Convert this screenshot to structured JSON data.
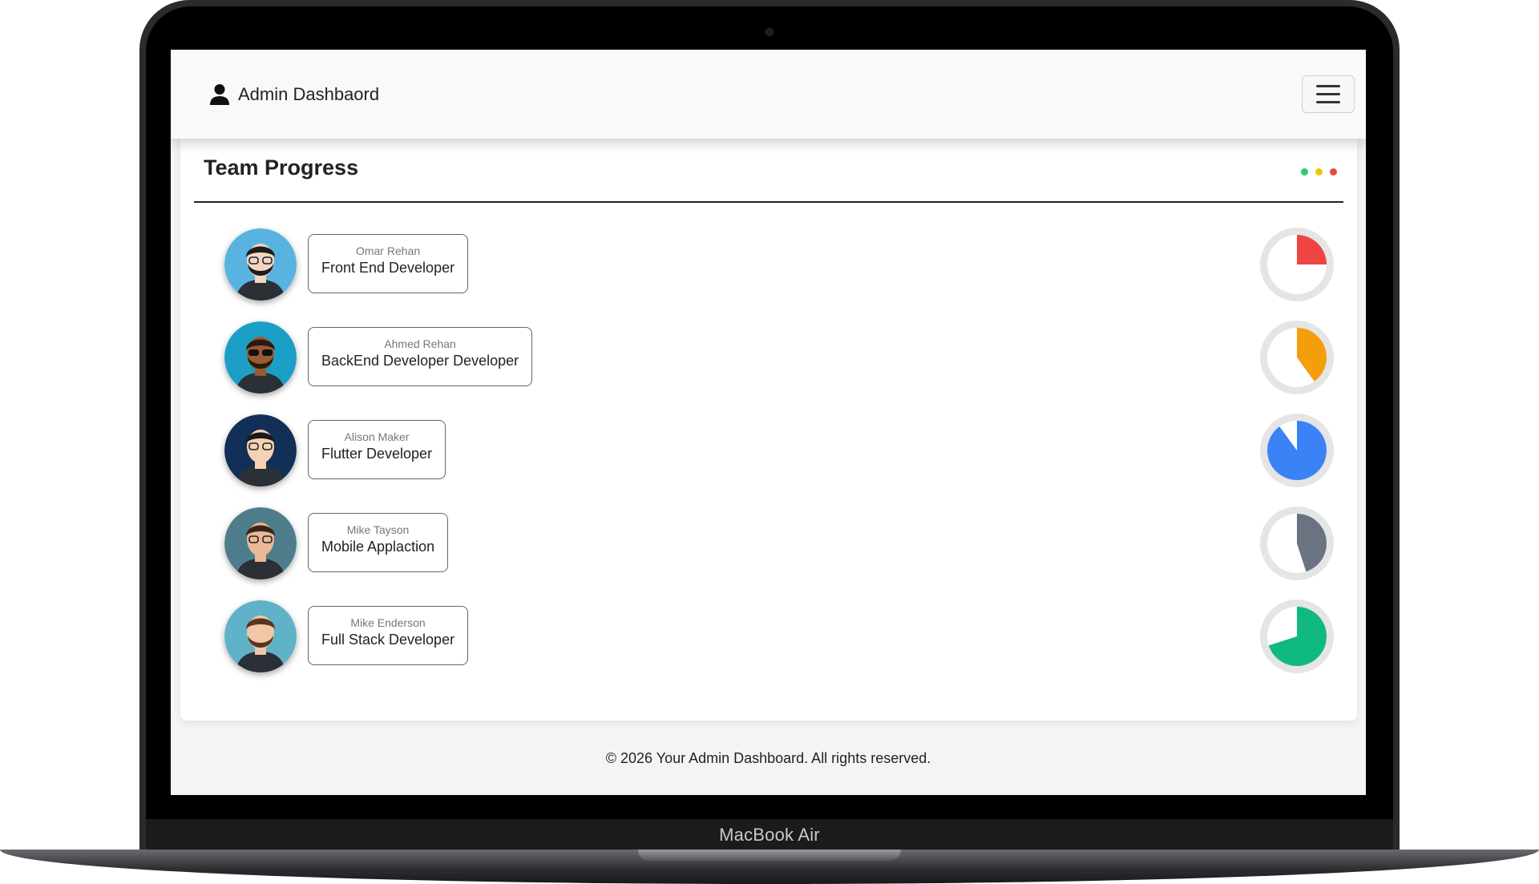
{
  "device": {
    "label": "MacBook Air"
  },
  "navbar": {
    "title": "Admin Dashbaord"
  },
  "card": {
    "title": "Team Progress",
    "dot_colors": [
      "#2ecc71",
      "#f1c40f",
      "#e74c3c"
    ]
  },
  "members": [
    {
      "name": "Omar Rehan",
      "role": "Front End Developer",
      "progress": 0.25,
      "color": "#ef4444",
      "avatar_bg": "#58b3e0"
    },
    {
      "name": "Ahmed Rehan",
      "role": "BackEnd Developer Developer",
      "progress": 0.4,
      "color": "#f59e0b",
      "avatar_bg": "#1b9fc6"
    },
    {
      "name": "Alison Maker",
      "role": "Flutter Developer",
      "progress": 0.9,
      "color": "#3b82f6",
      "avatar_bg": "#122f58"
    },
    {
      "name": "Mike Tayson",
      "role": "Mobile Applaction",
      "progress": 0.45,
      "color": "#6b7280",
      "avatar_bg": "#4d7d8a"
    },
    {
      "name": "Mike Enderson",
      "role": "Full Stack Developer",
      "progress": 0.7,
      "color": "#10b981",
      "avatar_bg": "#5fb2c7"
    }
  ],
  "footer": {
    "text": "© 2026 Your Admin Dashboard. All rights reserved."
  }
}
